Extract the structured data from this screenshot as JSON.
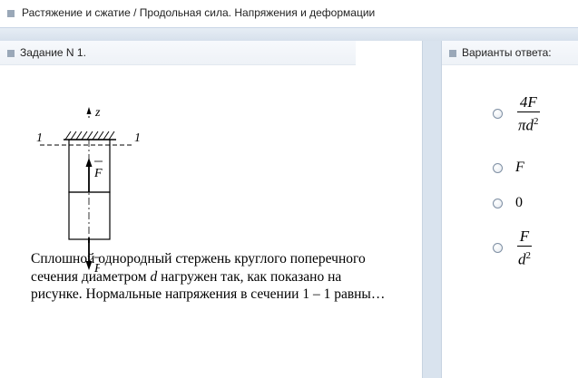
{
  "header": {
    "title": "Растяжение и сжатие / Продольная сила. Напряжения и деформации"
  },
  "task_panel": {
    "title": "Задание N 1."
  },
  "answers_panel": {
    "title": "Варианты ответа:"
  },
  "figure": {
    "axis_label": "z",
    "section_left": "1",
    "section_right": "1",
    "force_up": "F",
    "force_down": "F"
  },
  "question": {
    "part1": "Сплошной однородный стержень круглого поперечного сечения диаметром ",
    "var": "d",
    "part2": " нагружен так, как показано на рисунке. Нормальные напряжения в сечении ",
    "section": "1 – 1",
    "part3": " равны…"
  },
  "options": [
    {
      "num": "4F",
      "den_main": "πd",
      "den_sup": "2"
    },
    {
      "text": "F"
    },
    {
      "text": "0"
    },
    {
      "num": "F",
      "den_main": "d",
      "den_sup": "2"
    }
  ]
}
